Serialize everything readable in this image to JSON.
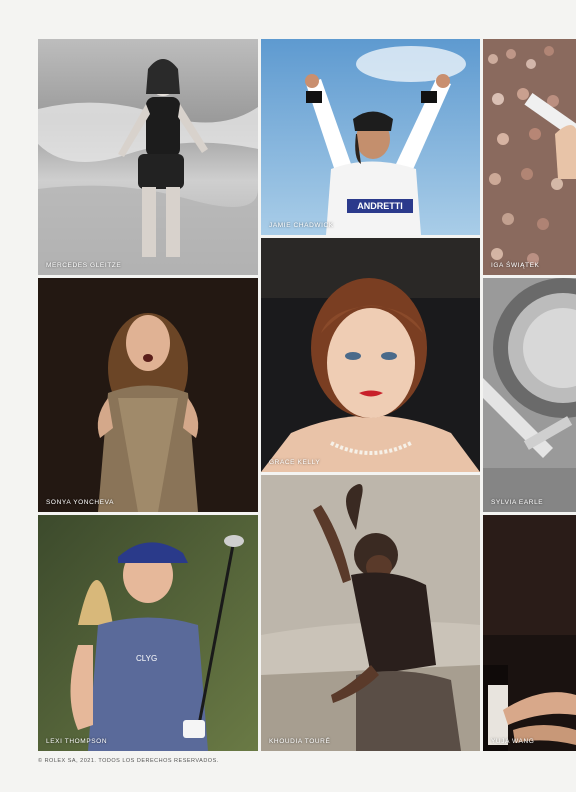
{
  "gallery": {
    "people": [
      {
        "name": "MERCEDES GLEITZE"
      },
      {
        "name": "JAMIE CHADWICK",
        "helmet_text": "ANDRETTI"
      },
      {
        "name": "IGA ŚWIĄTEK"
      },
      {
        "name": "SONYA YONCHEVA"
      },
      {
        "name": "GRACE KELLY"
      },
      {
        "name": "SYLVIA EARLE"
      },
      {
        "name": "LEXI THOMPSON",
        "shirt_text": "CLYG"
      },
      {
        "name": "KHOUDIA TOURÉ"
      },
      {
        "name": "YUJA WANG"
      }
    ]
  },
  "footer": {
    "copyright": "© ROLEX SA, 2021. TODOS LOS DERECHOS RESERVADOS."
  }
}
